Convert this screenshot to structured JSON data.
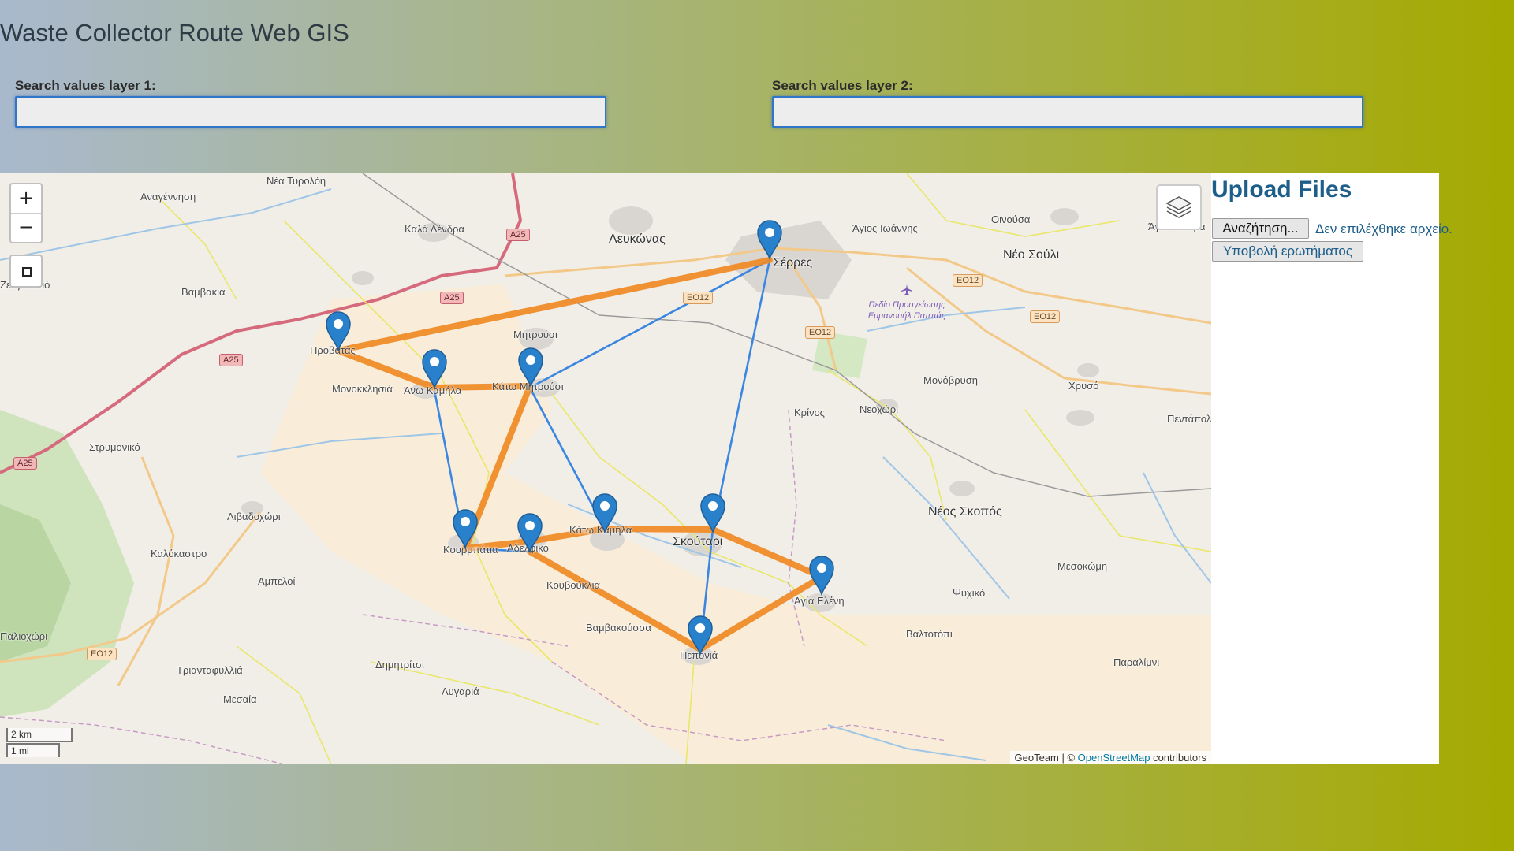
{
  "app": {
    "title": "Waste Collector Route Web GIS"
  },
  "search": {
    "layer1_label": "Search values layer 1:",
    "layer1_value": "",
    "layer2_label": "Search values layer 2:",
    "layer2_value": ""
  },
  "map": {
    "zoom_in": "+",
    "zoom_out": "−",
    "scale_km": "2 km",
    "scale_mi": "1 mi",
    "attribution_prefix": "GeoTeam | © ",
    "attribution_link": "OpenStreetMap",
    "attribution_suffix": " contributors",
    "places": [
      "Νέα Τυρολόη",
      "Αναγέννηση",
      "Καλά Δένδρα",
      "Λευκώνας",
      "Σέρρες",
      "Άγιος Ιωάννης",
      "Οινούσα",
      "Άγιο Πνεύμα",
      "Νέο Σούλι",
      "Ζευγολατιό",
      "Βαμβακιά",
      "Μητρούσι",
      "Μονοκκλησιά",
      "Άνω Καμήλα",
      "Κάτω Μητρούσι",
      "Μονόβρυση",
      "Χρυσό",
      "Κρίνος",
      "Νεοχώρι",
      "Πεντάπολη",
      "Στρυμονικό",
      "Νέος Σκοπός",
      "Λιβαδοχώρι",
      "Καλόκαστρο",
      "Κουρμπάτια",
      "Αδελφικό",
      "Κάτω Καμήλα",
      "Σκούταρι",
      "Μεσοκώμη",
      "Αμπελοί",
      "Κουβούκλια",
      "Αγία Ελένη",
      "Ψυχικό",
      "Βαλτοτόπι",
      "Παραλίμνι",
      "Βαμβακούσσα",
      "Πεπονιά",
      "Παλιοχώρι",
      "Τριανταφυλλιά",
      "Δημητρίτσι",
      "Μεσαία",
      "Λυγαριά",
      "Προβατάς"
    ],
    "road_badges": [
      "A25",
      "A25",
      "A25",
      "A25",
      "ΕΟ12",
      "ΕΟ12",
      "ΕΟ12",
      "ΕΟ12",
      "ΕΟ12"
    ],
    "airport_label": "Πεδίο Προσγείωσης Εμμανουήλ Παππάς",
    "route_color": "#f08a24",
    "link_color": "#3a86e0",
    "marker_color": "#2a81cb"
  },
  "upload": {
    "title": "Upload Files",
    "browse_label": "Αναζήτηση...",
    "no_file_label": "Δεν επιλέχθηκε αρχείο.",
    "submit_label": "Υποβολή ερωτήματος"
  }
}
